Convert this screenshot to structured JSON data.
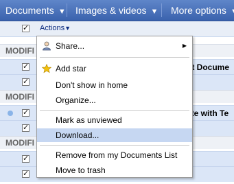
{
  "nav": {
    "documents": "Documents",
    "images_videos": "Images & videos",
    "more_options": "More options",
    "caret": "▼"
  },
  "toolbar": {
    "actions": "Actions",
    "actions_caret": "▼"
  },
  "list": {
    "group_label": "MODIFI",
    "row1_text": "nt Docume",
    "row2_text": "ate with Te"
  },
  "menu": {
    "share": "Share...",
    "add_star": "Add star",
    "dont_show_home": "Don't show in home",
    "organize": "Organize...",
    "mark_unviewed": "Mark as unviewed",
    "download": "Download...",
    "remove": "Remove from my Documents List",
    "trash": "Move to trash",
    "submenu_arrow": "▶"
  },
  "colors": {
    "nav_bg": "#4a72bb",
    "highlight": "#c6d7f2",
    "star": "#f4c20d"
  },
  "icons": [
    "share-people-icon",
    "star-icon",
    "submenu-arrow-icon",
    "checkbox-checked-icon",
    "unread-dot-icon"
  ]
}
